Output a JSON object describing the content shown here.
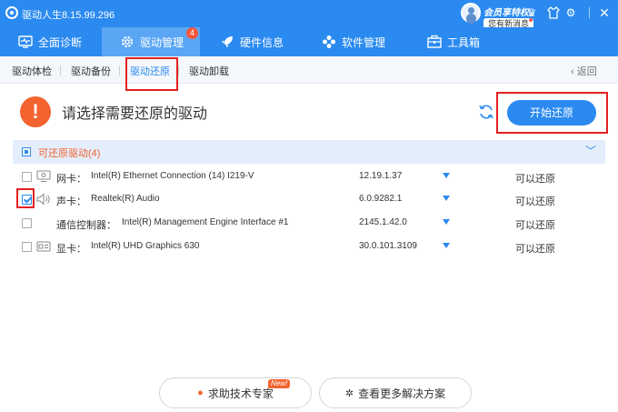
{
  "window": {
    "title": "驱动人生8.15.99.296",
    "vip_label": "会员享特权",
    "message_label": "您有新消息",
    "icons": [
      "avatar-icon",
      "crown-icon",
      "shirt-icon",
      "gear-icon",
      "minimize-icon",
      "close-icon"
    ]
  },
  "main_nav": {
    "tabs": [
      {
        "label": "全面诊断",
        "icon": "monitor-pulse-icon"
      },
      {
        "label": "驱动管理",
        "icon": "gear-icon",
        "active": true,
        "badge": "4"
      },
      {
        "label": "硬件信息",
        "icon": "rocket-icon"
      },
      {
        "label": "软件管理",
        "icon": "apps-icon"
      },
      {
        "label": "工具箱",
        "icon": "toolbox-icon"
      }
    ]
  },
  "sub_nav": {
    "tabs": [
      {
        "label": "驱动体检"
      },
      {
        "label": "驱动备份"
      },
      {
        "label": "驱动还原",
        "active": true
      },
      {
        "label": "驱动卸载"
      }
    ],
    "back_label": "返回"
  },
  "header": {
    "prompt": "请选择需要还原的驱动",
    "start_button": "开始还原"
  },
  "group": {
    "label": "可还原驱动(4)"
  },
  "drivers": [
    {
      "category": "网卡：",
      "name": "Intel(R) Ethernet Connection (14) I219-V",
      "version": "12.19.1.37",
      "status": "可以还原",
      "checked": false,
      "icon": "network-card-icon"
    },
    {
      "category": "声卡：",
      "name": "Realtek(R) Audio",
      "version": "6.0.9282.1",
      "status": "可以还原",
      "checked": true,
      "icon": "speaker-icon"
    },
    {
      "category": "通信控制器：",
      "name": "Intel(R) Management Engine Interface #1",
      "version": "2145.1.42.0",
      "status": "可以还原",
      "checked": false,
      "icon": "controller-icon"
    },
    {
      "category": "显卡：",
      "name": "Intel(R) UHD Graphics 630",
      "version": "30.0.101.3109",
      "status": "可以还原",
      "checked": false,
      "icon": "display-card-icon"
    }
  ],
  "footer": {
    "expert_button": "求助技术专家",
    "new_tag": "New!",
    "solutions_button": "查看更多解决方案"
  },
  "colors": {
    "brand_blue": "#2a8af0",
    "active_tab": "#5aa6f5",
    "warning_orange": "#f2632f",
    "highlight_red": "#e62020"
  }
}
